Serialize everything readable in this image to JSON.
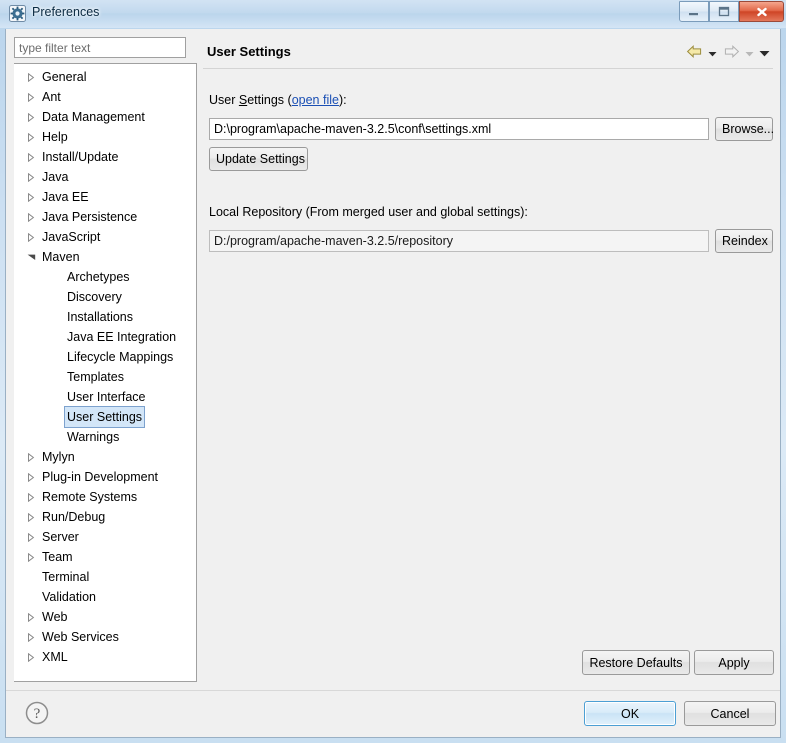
{
  "window": {
    "title": "Preferences",
    "icon": "gear-icon",
    "controls": {
      "minimize": "Minimize",
      "maximize": "Maximize",
      "close": "Close"
    }
  },
  "sidebar": {
    "filter": {
      "value": "",
      "placeholder": "type filter text"
    },
    "items": [
      {
        "label": "General",
        "level": 1,
        "expandable": true,
        "expanded": false,
        "selected": false
      },
      {
        "label": "Ant",
        "level": 1,
        "expandable": true,
        "expanded": false,
        "selected": false
      },
      {
        "label": "Data Management",
        "level": 1,
        "expandable": true,
        "expanded": false,
        "selected": false
      },
      {
        "label": "Help",
        "level": 1,
        "expandable": true,
        "expanded": false,
        "selected": false
      },
      {
        "label": "Install/Update",
        "level": 1,
        "expandable": true,
        "expanded": false,
        "selected": false
      },
      {
        "label": "Java",
        "level": 1,
        "expandable": true,
        "expanded": false,
        "selected": false
      },
      {
        "label": "Java EE",
        "level": 1,
        "expandable": true,
        "expanded": false,
        "selected": false
      },
      {
        "label": "Java Persistence",
        "level": 1,
        "expandable": true,
        "expanded": false,
        "selected": false
      },
      {
        "label": "JavaScript",
        "level": 1,
        "expandable": true,
        "expanded": false,
        "selected": false
      },
      {
        "label": "Maven",
        "level": 1,
        "expandable": true,
        "expanded": true,
        "selected": false
      },
      {
        "label": "Archetypes",
        "level": 2,
        "expandable": false,
        "expanded": false,
        "selected": false
      },
      {
        "label": "Discovery",
        "level": 2,
        "expandable": false,
        "expanded": false,
        "selected": false
      },
      {
        "label": "Installations",
        "level": 2,
        "expandable": false,
        "expanded": false,
        "selected": false
      },
      {
        "label": "Java EE Integration",
        "level": 2,
        "expandable": false,
        "expanded": false,
        "selected": false
      },
      {
        "label": "Lifecycle Mappings",
        "level": 2,
        "expandable": false,
        "expanded": false,
        "selected": false
      },
      {
        "label": "Templates",
        "level": 2,
        "expandable": false,
        "expanded": false,
        "selected": false
      },
      {
        "label": "User Interface",
        "level": 2,
        "expandable": false,
        "expanded": false,
        "selected": false
      },
      {
        "label": "User Settings",
        "level": 2,
        "expandable": false,
        "expanded": false,
        "selected": true
      },
      {
        "label": "Warnings",
        "level": 2,
        "expandable": false,
        "expanded": false,
        "selected": false
      },
      {
        "label": "Mylyn",
        "level": 1,
        "expandable": true,
        "expanded": false,
        "selected": false
      },
      {
        "label": "Plug-in Development",
        "level": 1,
        "expandable": true,
        "expanded": false,
        "selected": false
      },
      {
        "label": "Remote Systems",
        "level": 1,
        "expandable": true,
        "expanded": false,
        "selected": false
      },
      {
        "label": "Run/Debug",
        "level": 1,
        "expandable": true,
        "expanded": false,
        "selected": false
      },
      {
        "label": "Server",
        "level": 1,
        "expandable": true,
        "expanded": false,
        "selected": false
      },
      {
        "label": "Team",
        "level": 1,
        "expandable": true,
        "expanded": false,
        "selected": false
      },
      {
        "label": "Terminal",
        "level": 1,
        "expandable": false,
        "expanded": false,
        "selected": false
      },
      {
        "label": "Validation",
        "level": 1,
        "expandable": false,
        "expanded": false,
        "selected": false
      },
      {
        "label": "Web",
        "level": 1,
        "expandable": true,
        "expanded": false,
        "selected": false
      },
      {
        "label": "Web Services",
        "level": 1,
        "expandable": true,
        "expanded": false,
        "selected": false
      },
      {
        "label": "XML",
        "level": 1,
        "expandable": true,
        "expanded": false,
        "selected": false
      }
    ]
  },
  "page": {
    "title": "User Settings",
    "nav": {
      "back_icon": "back-arrow-icon",
      "back_menu_icon": "chevron-down-icon",
      "forward_icon": "forward-arrow-icon",
      "forward_menu_icon": "chevron-down-icon",
      "menu_icon": "chevron-down-icon"
    },
    "user_settings": {
      "label_prefix": "User ",
      "label_mnemonic": "S",
      "label_rest": "ettings (",
      "link": "open file",
      "label_suffix": "):",
      "value": "D:\\program\\apache-maven-3.2.5\\conf\\settings.xml",
      "browse_label": "Browse...",
      "update_label": "Update Settings"
    },
    "local_repository": {
      "label": "Local Repository (From merged user and global settings):",
      "value": "D:/program/apache-maven-3.2.5/repository",
      "reindex_label": "Reindex"
    },
    "restore_defaults_label": "Restore Defaults",
    "apply_label": "Apply"
  },
  "footer": {
    "help_icon": "help-question-icon",
    "ok_label": "OK",
    "cancel_label": "Cancel"
  },
  "colors": {
    "selection_fill": "#d3e6f8",
    "selection_border": "#7da2ce",
    "link": "#1a4fb4",
    "default_button_border": "#4c9fd4",
    "close_button": "#cf4526"
  }
}
